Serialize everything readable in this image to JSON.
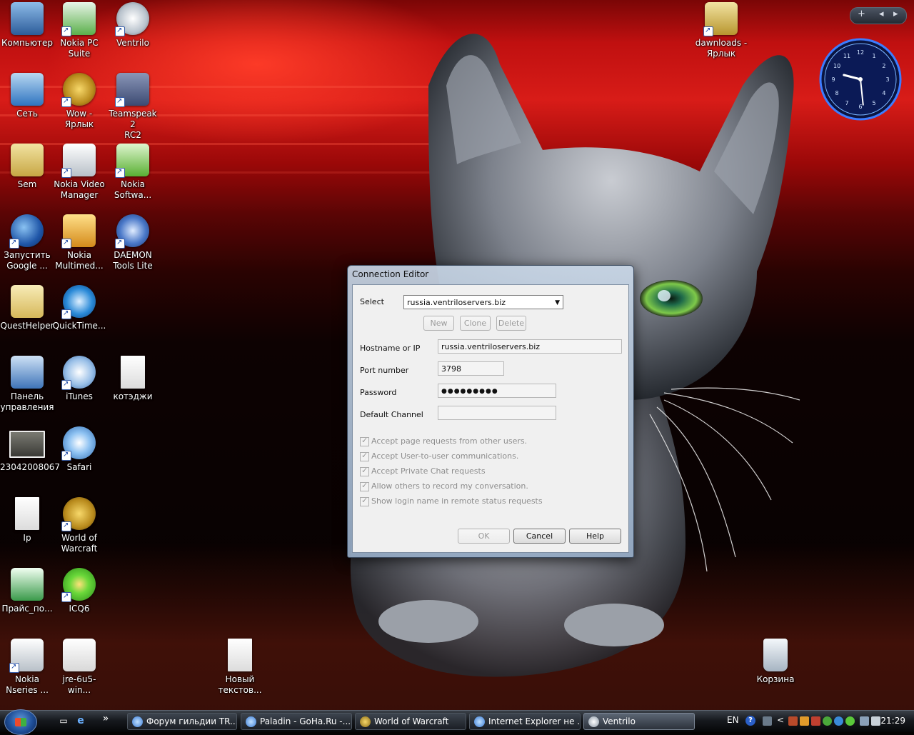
{
  "desktop": {
    "icons": [
      {
        "label": "Компьютер",
        "icon": "computer-icon",
        "color": "#4a86c8"
      },
      {
        "label": "Nokia PC\nSuite",
        "icon": "nokia-pc-suite-icon",
        "color": "#5ab04a"
      },
      {
        "label": "Ventrilo",
        "icon": "ventrilo-icon",
        "color": "#e8e8e8"
      },
      {
        "label": "Сеть",
        "icon": "network-icon",
        "color": "#3a8fd8"
      },
      {
        "label": "Wow -\nЯрлык",
        "icon": "wow-icon",
        "color": "#c9a22c"
      },
      {
        "label": "Teamspeak 2\nRC2",
        "icon": "teamspeak-icon",
        "color": "#5c6a90"
      },
      {
        "label": "Sem",
        "icon": "folder-icon",
        "color": "#d8c46a"
      },
      {
        "label": "Nokia Video\nManager",
        "icon": "nokia-video-manager-icon",
        "color": "#d8d8d8"
      },
      {
        "label": "Nokia\nSoftwa...",
        "icon": "nokia-software-icon",
        "color": "#6fc24a"
      },
      {
        "label": "Запустить\nGoogle ...",
        "icon": "google-earth-icon",
        "color": "#2b63b8"
      },
      {
        "label": "Nokia\nMultimed...",
        "icon": "nokia-multimedia-icon",
        "color": "#e0a030"
      },
      {
        "label": "DAEMON\nTools Lite",
        "icon": "daemon-tools-icon",
        "color": "#3d68b8"
      },
      {
        "label": "QuestHelper",
        "icon": "folder-icon",
        "color": "#e2cb7a"
      },
      {
        "label": "QuickTime...",
        "icon": "quicktime-icon",
        "color": "#2a8ad8"
      },
      {
        "label": "Панель\nуправления",
        "icon": "control-panel-icon",
        "color": "#4a80c0"
      },
      {
        "label": "iTunes",
        "icon": "itunes-icon",
        "color": "#7aa8d8"
      },
      {
        "label": "котэджи",
        "icon": "text-file-icon",
        "color": "#f2f2f2"
      },
      {
        "label": "23042008067",
        "icon": "image-file-icon",
        "color": "#555555"
      },
      {
        "label": "Safari",
        "icon": "safari-icon",
        "color": "#5a9ee0"
      },
      {
        "label": "Ip",
        "icon": "text-file-icon",
        "color": "#f2f2f2"
      },
      {
        "label": "World of\nWarcraft",
        "icon": "wow-icon",
        "color": "#c9a22c"
      },
      {
        "label": "Прайс_по...",
        "icon": "excel-file-icon",
        "color": "#3a9a4a"
      },
      {
        "label": "ICQ6",
        "icon": "icq-icon",
        "color": "#5cc83a"
      },
      {
        "label": "Nokia\nNseries ...",
        "icon": "nokia-nseries-icon",
        "color": "#d8d8d8"
      },
      {
        "label": "jre-6u5-win...",
        "icon": "java-installer-icon",
        "color": "#e8e8e8"
      },
      {
        "label": "Новый\nтекстов...",
        "icon": "text-file-icon",
        "color": "#f2f2f2"
      },
      {
        "label": "dawnloads -\nЯрлык",
        "icon": "folder-music-icon",
        "color": "#d8c46a"
      },
      {
        "label": "Корзина",
        "icon": "recycle-bin-icon",
        "color": "#cfd8e2"
      }
    ]
  },
  "gadgets": {
    "sidebar_add": "+",
    "sidebar_prev": "◂",
    "sidebar_next": "▸",
    "clock_numbers": [
      "12",
      "1",
      "2",
      "3",
      "4",
      "5",
      "6",
      "7",
      "8",
      "9",
      "10",
      "11"
    ],
    "clock_time": "21:29"
  },
  "dialog": {
    "title": "Connection Editor",
    "select_label": "Select",
    "select_value": "russia.ventriloservers.biz",
    "buttons_top": {
      "new": "New",
      "clone": "Clone",
      "delete": "Delete"
    },
    "hostname_label": "Hostname or IP",
    "hostname_value": "russia.ventriloservers.biz",
    "port_label": "Port number",
    "port_value": "3798",
    "password_label": "Password",
    "password_value": "●●●●●●●●●",
    "channel_label": "Default Channel",
    "channel_value": "",
    "options": [
      "Accept page requests from other users.",
      "Accept User-to-user communications.",
      "Accept Private Chat requests",
      "Allow others to record my conversation.",
      "Show login name in remote status requests"
    ],
    "buttons_bottom": {
      "ok": "OK",
      "cancel": "Cancel",
      "help": "Help"
    }
  },
  "taskbar": {
    "quicklaunch_more": "»",
    "tasks": [
      {
        "label": "Форум гильдии TR...",
        "icon": "internet-explorer-icon",
        "color": "#3a7bd5"
      },
      {
        "label": "Paladin - GoHa.Ru -...",
        "icon": "internet-explorer-icon",
        "color": "#3a7bd5"
      },
      {
        "label": "World of Warcraft",
        "icon": "wow-icon",
        "color": "#c9a22c"
      },
      {
        "label": "Internet Explorer не ...",
        "icon": "internet-explorer-icon",
        "color": "#3a7bd5"
      },
      {
        "label": "Ventrilo",
        "icon": "ventrilo-icon",
        "color": "#cfd6df"
      }
    ],
    "language": "EN",
    "help": "?",
    "expand": "<",
    "time": "21:29"
  },
  "colors": {
    "dialog_frame": "#9fb4cc",
    "taskbar": "#16191e",
    "wallpaper_red": "#c01010"
  }
}
